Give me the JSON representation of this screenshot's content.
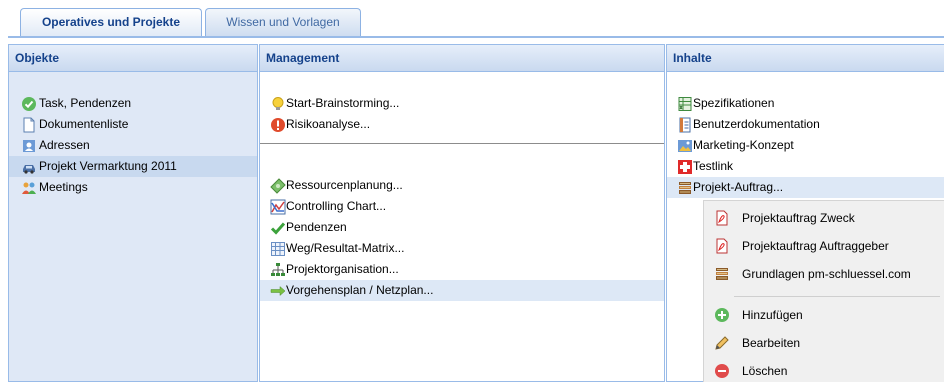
{
  "tabs": [
    {
      "label": "Operatives und Projekte",
      "active": true
    },
    {
      "label": "Wissen und Vorlagen",
      "active": false
    }
  ],
  "panels": {
    "objekte": {
      "title": "Objekte",
      "items": [
        {
          "label": "Task, Pendenzen",
          "icon": "check-circle-icon"
        },
        {
          "label": "Dokumentenliste",
          "icon": "document-icon"
        },
        {
          "label": "Adressen",
          "icon": "address-book-icon"
        },
        {
          "label": "Projekt Vermarktung 2011",
          "icon": "car-icon",
          "selected": true
        },
        {
          "label": "Meetings",
          "icon": "people-icon"
        }
      ]
    },
    "management": {
      "title": "Management",
      "group1": [
        {
          "label": "Start-Brainstorming...",
          "icon": "lightbulb-icon"
        },
        {
          "label": "Risikoanalyse...",
          "icon": "warning-circle-icon"
        }
      ],
      "group2": [
        {
          "label": "Ressourcenplanung...",
          "icon": "money-icon"
        },
        {
          "label": "Controlling Chart...",
          "icon": "chart-icon"
        },
        {
          "label": "Pendenzen",
          "icon": "checkmark-icon"
        },
        {
          "label": "Weg/Resultat-Matrix...",
          "icon": "table-icon"
        },
        {
          "label": "Projektorganisation...",
          "icon": "org-chart-icon"
        },
        {
          "label": "Vorgehensplan / Netzplan...",
          "icon": "arrow-right-icon",
          "selected": true
        }
      ]
    },
    "inhalte": {
      "title": "Inhalte",
      "items": [
        {
          "label": "Spezifikationen",
          "icon": "spreadsheet-icon"
        },
        {
          "label": "Benutzerdokumentation",
          "icon": "text-doc-icon"
        },
        {
          "label": "Marketing-Konzept",
          "icon": "image-doc-icon"
        },
        {
          "label": "Testlink",
          "icon": "red-cross-icon"
        },
        {
          "label": "Projekt-Auftrag...",
          "icon": "books-icon",
          "selected": true
        }
      ]
    }
  },
  "context_menu": {
    "items": [
      {
        "label": "Projektauftrag Zweck",
        "icon": "pdf-icon"
      },
      {
        "label": "Projektauftrag Auftraggeber",
        "icon": "pdf-icon"
      },
      {
        "label": "Grundlagen pm-schluessel.com",
        "icon": "books-icon"
      },
      {
        "label": "Hinzufügen",
        "icon": "add-icon"
      },
      {
        "label": "Bearbeiten",
        "icon": "edit-icon"
      },
      {
        "label": "Löschen",
        "icon": "delete-icon"
      }
    ]
  }
}
